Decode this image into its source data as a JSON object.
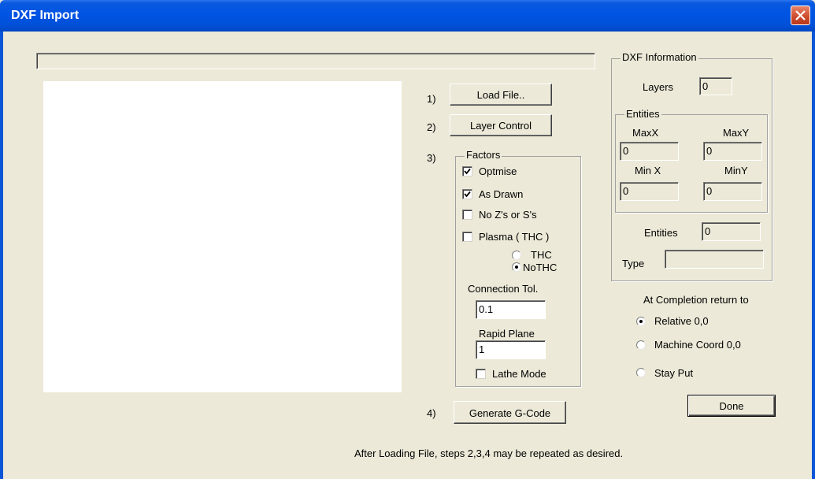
{
  "window": {
    "title": "DXF Import"
  },
  "steps": {
    "step1": "1)",
    "step2": "2)",
    "step3": "3)",
    "step4": "4)",
    "load_file": "Load File..",
    "layer_control": "Layer Control",
    "generate": "Generate G-Code"
  },
  "factors": {
    "legend": "Factors",
    "optimise": {
      "label": "Optmise",
      "checked": true
    },
    "as_drawn": {
      "label": "As Drawn",
      "checked": true
    },
    "no_zs": {
      "label": "No Z's or S's",
      "checked": false
    },
    "plasma": {
      "label": "Plasma ( THC )",
      "checked": false
    },
    "thc": {
      "label": "THC",
      "selected": false
    },
    "nothc": {
      "label": "NoTHC",
      "selected": true
    },
    "connection_tol_label": "Connection Tol.",
    "connection_tol_value": "0.1",
    "rapid_plane_label": "Rapid Plane",
    "rapid_plane_value": "1",
    "lathe_mode": {
      "label": "Lathe Mode",
      "checked": false
    }
  },
  "dxf_info": {
    "legend": "DXF Information",
    "layers_label": "Layers",
    "layers_value": "0",
    "entities_group": "Entities",
    "maxx_label": "MaxX",
    "maxx_value": "0",
    "maxy_label": "MaxY",
    "maxy_value": "0",
    "minx_label": "Min X",
    "minx_value": "0",
    "miny_label": "MinY",
    "miny_value": "0",
    "entities_label": "Entities",
    "entities_value": "0",
    "type_label": "Type",
    "type_value": ""
  },
  "completion": {
    "label": "At Completion return to",
    "options": [
      {
        "label": "Relative 0,0",
        "selected": true
      },
      {
        "label": "Machine Coord 0,0",
        "selected": false
      },
      {
        "label": "Stay Put",
        "selected": false
      }
    ]
  },
  "done_label": "Done",
  "footer_note": "After Loading File, steps 2,3,4 may be repeated as desired."
}
